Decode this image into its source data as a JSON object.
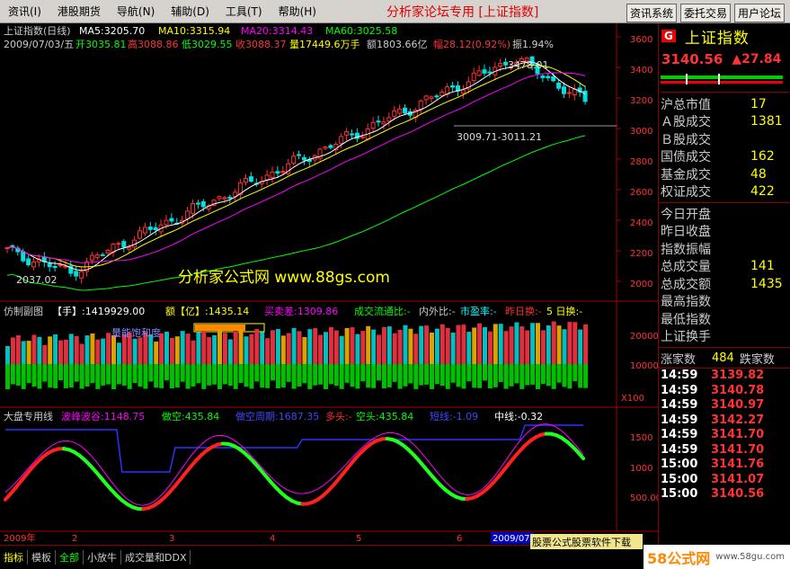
{
  "menu": {
    "items": [
      "资讯(I)",
      "港股期货",
      "导航(N)",
      "辅助(D)",
      "工具(T)",
      "帮助(H)"
    ],
    "title": "分析家论坛专用 [上证指数]",
    "buttons": [
      "资讯系统",
      "委托交易",
      "用户论坛"
    ]
  },
  "main": {
    "title": "上证指数(日线)",
    "ma": [
      {
        "label": "MA5:3205.70",
        "color": "#ffffff"
      },
      {
        "label": "MA10:3315.94",
        "color": "#ffff00"
      },
      {
        "label": "MA20:3314.43",
        "color": "#ff00ff"
      },
      {
        "label": "MA60:3025.58",
        "color": "#00ff00"
      }
    ],
    "info": {
      "date": "2009/07/03/五",
      "open": "开3035.81",
      "high": "高3088.86",
      "low": "低3029.55",
      "close": "收3088.37",
      "vol": "量17449.6万手",
      "amt": "额1803.66亿",
      "chg": "幅28.12(0.92%)",
      "amp": "振1.94%"
    },
    "annot_high": "3478.01",
    "annot_low": "2037.02",
    "annot_range": "3009.71-3011.21",
    "watermark": "分析家公式网  www.88gs.com",
    "ylabels": [
      "3600",
      "3400",
      "3200",
      "3000",
      "2800",
      "2600",
      "2400",
      "2200",
      "2000"
    ]
  },
  "sub1": {
    "title": "仿制副图",
    "hand": "【手】:1419929.00",
    "amt": "额【亿】:1435.14",
    "diff": "买卖差:1309.86",
    "flow": "成交流通比:-",
    "inout": "内外比:-",
    "pe": "市盈率:-",
    "yday": "昨日换:-",
    "five": "5 日换:-",
    "energy": "量能饱和度",
    "ylabels": [
      "20000",
      "10000"
    ],
    "unit": "X100"
  },
  "sub2": {
    "title": "大盘专用线",
    "wave": "波峰波谷:1148.75",
    "short": "做空:435.84",
    "cycle": "做空周期:1687.35",
    "long": "多头:-",
    "empty": "空头:435.84",
    "sline": "短线:-1.09",
    "mline": "中线:-0.32",
    "ylabels": [
      "1500",
      "1000",
      "500.00"
    ]
  },
  "xaxis": {
    "year": "2009年",
    "months": [
      "2",
      "3",
      "4",
      "5",
      "6",
      "7"
    ],
    "cursor": "2009/07"
  },
  "side": {
    "badge": "G",
    "name": "上证指数",
    "price": "3140.56",
    "change": "▲27.84",
    "rows": [
      {
        "l": "沪总市值",
        "v": "17"
      },
      {
        "l": "Ａ股成交",
        "v": "1381"
      },
      {
        "l": "Ｂ股成交",
        "v": ""
      },
      {
        "l": "国债成交",
        "v": "162"
      },
      {
        "l": "基金成交",
        "v": "48"
      },
      {
        "l": "权证成交",
        "v": "422"
      }
    ],
    "rows2": [
      "今日开盘",
      "昨日收盘",
      "指数振幅",
      "总成交量",
      "总成交额",
      "最高指数",
      "最低指数",
      "上证换手"
    ],
    "rows2v": [
      "",
      "",
      "",
      "141",
      "1435",
      "",
      "",
      ""
    ],
    "updown": {
      "up_label": "涨家数",
      "up": "484",
      "down_label": "跌家数"
    },
    "ticks": [
      {
        "t": "14:59",
        "p": "3139.82"
      },
      {
        "t": "14:59",
        "p": "3140.78"
      },
      {
        "t": "14:59",
        "p": "3140.97"
      },
      {
        "t": "14:59",
        "p": "3142.27"
      },
      {
        "t": "14:59",
        "p": "3141.70"
      },
      {
        "t": "14:59",
        "p": "3141.70"
      },
      {
        "t": "15:00",
        "p": "3141.76"
      },
      {
        "t": "15:00",
        "p": "3141.07"
      },
      {
        "t": "15:00",
        "p": "3140.56"
      }
    ]
  },
  "bottom": {
    "tabs": [
      "指标",
      "模板",
      "全部",
      "小放牛",
      "成交量和DDX"
    ],
    "ad": "股票公式股票软件下载",
    "logo": "58公式网",
    "url": "www.58gu.com"
  },
  "colors": {
    "up": "#ff3030",
    "down": "#00e0e0",
    "ma5": "#ffffff",
    "ma10": "#ffff00",
    "ma20": "#ff00ff",
    "ma60": "#00ff00"
  }
}
